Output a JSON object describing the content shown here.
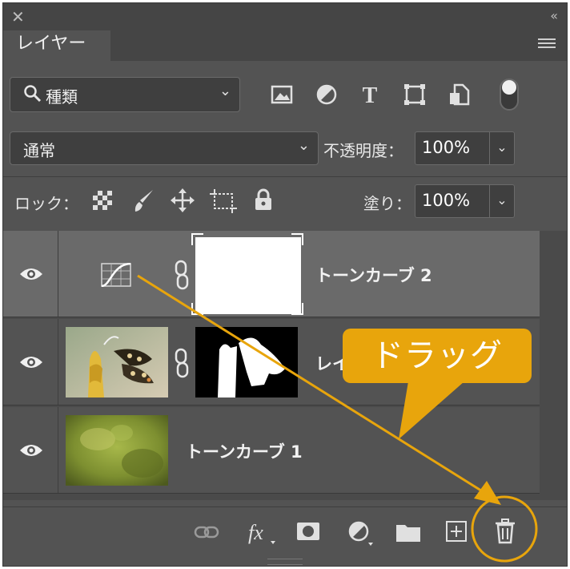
{
  "panel": {
    "tab_label": "レイヤー"
  },
  "filter": {
    "kind_label": "種類"
  },
  "blend": {
    "mode": "通常",
    "opacity_label": "不透明度：",
    "opacity_value": "100%"
  },
  "lock": {
    "label": "ロック：",
    "fill_label": "塗り：",
    "fill_value": "100%"
  },
  "layers": [
    {
      "name": "トーンカーブ 2",
      "type": "adjustment",
      "selected": true
    },
    {
      "name": "レイ",
      "type": "image-with-mask",
      "selected": false
    },
    {
      "name": "トーンカーブ 1",
      "type": "image",
      "selected": false
    }
  ],
  "annotation": {
    "callout_text": "ドラッグ",
    "accent_color": "#e8a50c"
  }
}
